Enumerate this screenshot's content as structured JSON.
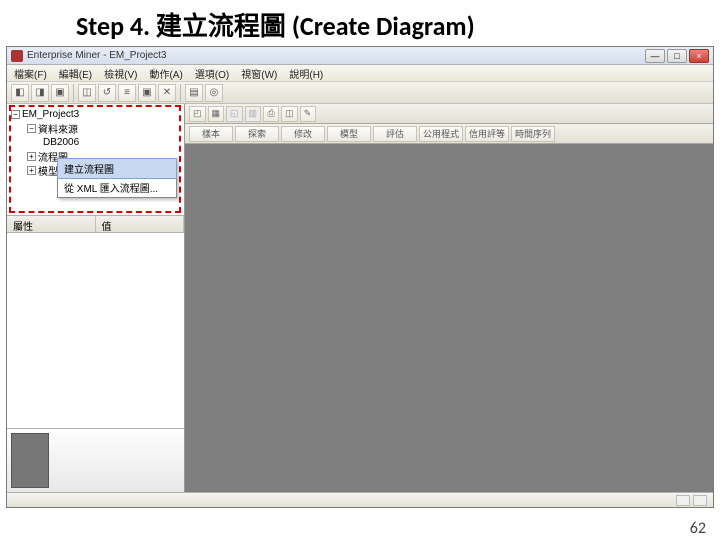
{
  "slide": {
    "step": "Step 4.",
    "title_zh": "建立流程圖",
    "title_en": "(Create Diagram)",
    "page_number": "62"
  },
  "window": {
    "title": "Enterprise Miner - EM_Project3",
    "controls": {
      "min": "—",
      "max": "□",
      "close": "×"
    }
  },
  "menu": {
    "file": "檔案(F)",
    "edit": "編輯(E)",
    "view": "檢視(V)",
    "actions": "動作(A)",
    "options": "選項(O)",
    "window": "視窗(W)",
    "help": "說明(H)"
  },
  "toolbar_glyphs": [
    "◧",
    "◨",
    "▣",
    "◫",
    "↺",
    "≡",
    "▣",
    "✕",
    "▤",
    "◎"
  ],
  "tree": {
    "root": "EM_Project3",
    "datasources": "資料來源",
    "ds_item": "DB2006",
    "diagrams": "流程圖",
    "models": "模型套件"
  },
  "context_menu": {
    "create": "建立流程圖",
    "import_xml": "從 XML 匯入流程圖..."
  },
  "props": {
    "col_name": "屬性",
    "col_value": "值"
  },
  "right_tabs": {
    "sample": "樣本",
    "explore": "探索",
    "modify": "修改",
    "model": "模型",
    "assess": "評估",
    "utility": "公用程式",
    "credit": "信用評等",
    "applications": "時間序列"
  },
  "right_icons": [
    "◰",
    "▦",
    "◱",
    "▥",
    "⎙",
    "◫",
    "✎"
  ],
  "status": {
    "indicator": "■"
  }
}
